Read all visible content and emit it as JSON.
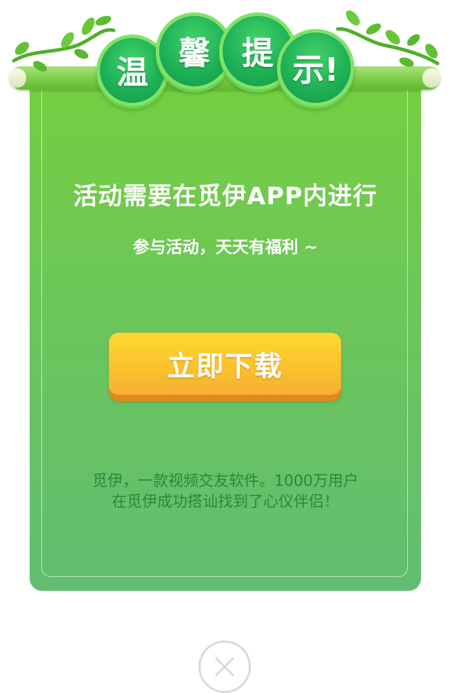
{
  "dialog": {
    "title_chars": [
      "温",
      "馨",
      "提",
      "示!"
    ],
    "headline": "活动需要在觅伊APP内进行",
    "subline": "参与活动，天天有福利 ~",
    "download_label": "立即下载",
    "description_line1": "觅伊，一款视频交友软件。1000万用户",
    "description_line2": "在觅伊成功搭讪找到了心仪伴侣！",
    "close_icon": "close-icon"
  },
  "colors": {
    "card_green": "#6cc65a",
    "title_bubble": "#1fb156",
    "button_yellow": "#fbc22e",
    "description_text": "#27893a"
  }
}
